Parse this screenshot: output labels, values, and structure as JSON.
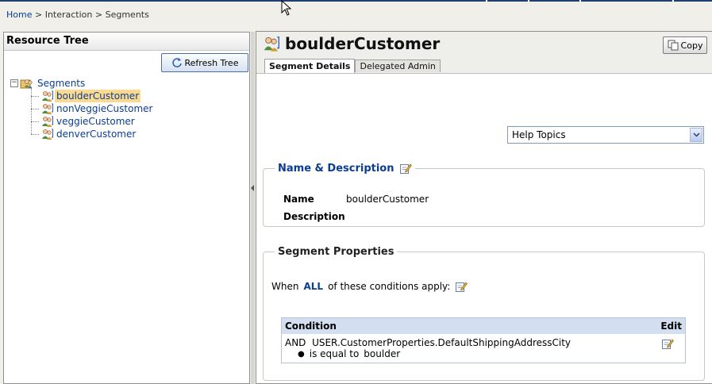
{
  "breadcrumb": {
    "home": "Home",
    "sep1": ">",
    "interaction": "Interaction",
    "sep2": ">",
    "current": "Segments"
  },
  "left_panel": {
    "title": "Resource Tree",
    "refresh_label": "Refresh Tree",
    "tree": {
      "root_expander": "−",
      "root_label": "Segments",
      "items": [
        {
          "label": "boulderCustomer",
          "selected": true
        },
        {
          "label": "nonVeggieCustomer",
          "selected": false
        },
        {
          "label": "veggieCustomer",
          "selected": false
        },
        {
          "label": "denverCustomer",
          "selected": false
        }
      ]
    }
  },
  "right_panel": {
    "title": "boulderCustomer",
    "copy_label": "Copy",
    "tabs": [
      {
        "label": "Segment Details",
        "active": true
      },
      {
        "label": "Delegated Admin",
        "active": false
      }
    ],
    "help_select": {
      "value": "Help Topics"
    },
    "name_description": {
      "legend": "Name & Description",
      "name_label": "Name",
      "name_value": "boulderCustomer",
      "description_label": "Description",
      "description_value": ""
    },
    "segment_properties": {
      "legend": "Segment Properties",
      "when_prefix": "When",
      "when_mode": "ALL",
      "when_suffix": "of these conditions apply:",
      "table": {
        "col_condition": "Condition",
        "col_edit": "Edit",
        "rows": [
          {
            "operator": "AND",
            "property": "USER.CustomerProperties.DefaultShippingAddressCity",
            "comparison": "is equal to",
            "value": "boulder"
          }
        ]
      }
    }
  },
  "colors": {
    "link": "#0b3d91",
    "selected_highlight": "#fbd98f",
    "table_header": "#d3dff0"
  },
  "icons": {
    "segment": "segment-people-icon",
    "refresh": "refresh-icon",
    "copy": "copy-icon",
    "edit": "edit-pencil-icon",
    "dropdown": "chevron-down-icon"
  }
}
